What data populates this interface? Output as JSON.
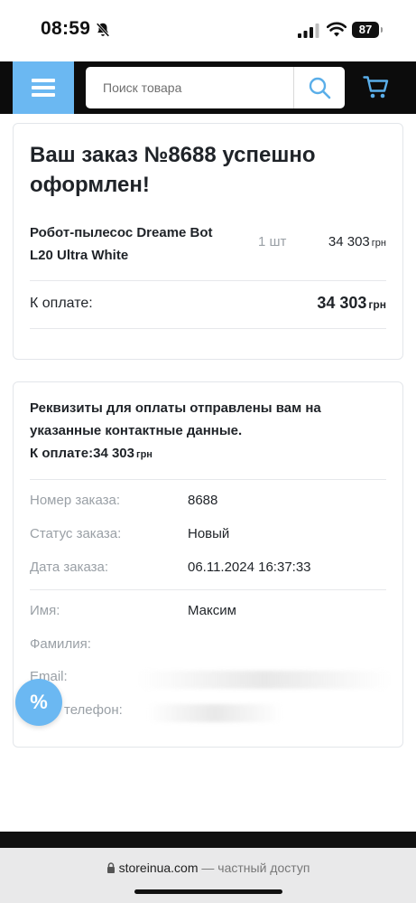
{
  "status_bar": {
    "time": "08:59",
    "battery": "87",
    "icons": [
      "bell-off-icon",
      "signal-icon",
      "wifi-icon",
      "battery-icon"
    ]
  },
  "header": {
    "search_placeholder": "Поиск товара",
    "icons": [
      "menu-icon",
      "search-icon",
      "cart-icon"
    ],
    "accent_color": "#6bb8f2"
  },
  "order": {
    "title": "Ваш заказ №8688 успешно оформлен!",
    "product_name": "Робот-пылесос Dreame Bot L20 Ultra White",
    "qty": "1 шт",
    "price": "34 303",
    "currency": "грн",
    "total_label": "К оплате:",
    "total_value": "34 303"
  },
  "details": {
    "notice": "Реквизиты для оплаты отправлены вам на указанные контактные данные.",
    "notice_total_label": "К оплате:",
    "notice_total_value": "34 303",
    "rows": [
      {
        "label": "Номер заказа:",
        "value": "8688"
      },
      {
        "label": "Статус заказа:",
        "value": "Новый"
      },
      {
        "label": "Дата заказа:",
        "value": "06.11.2024 16:37:33"
      },
      {
        "label": "Имя:",
        "value": "Максим"
      },
      {
        "label": "Фамилия:",
        "value": ""
      },
      {
        "label": "Email:",
        "value": ""
      },
      {
        "label": "телефон:",
        "value": ""
      }
    ]
  },
  "promo_button": "%",
  "browser": {
    "domain": "storeinua.com",
    "suffix": "— частный доступ"
  }
}
